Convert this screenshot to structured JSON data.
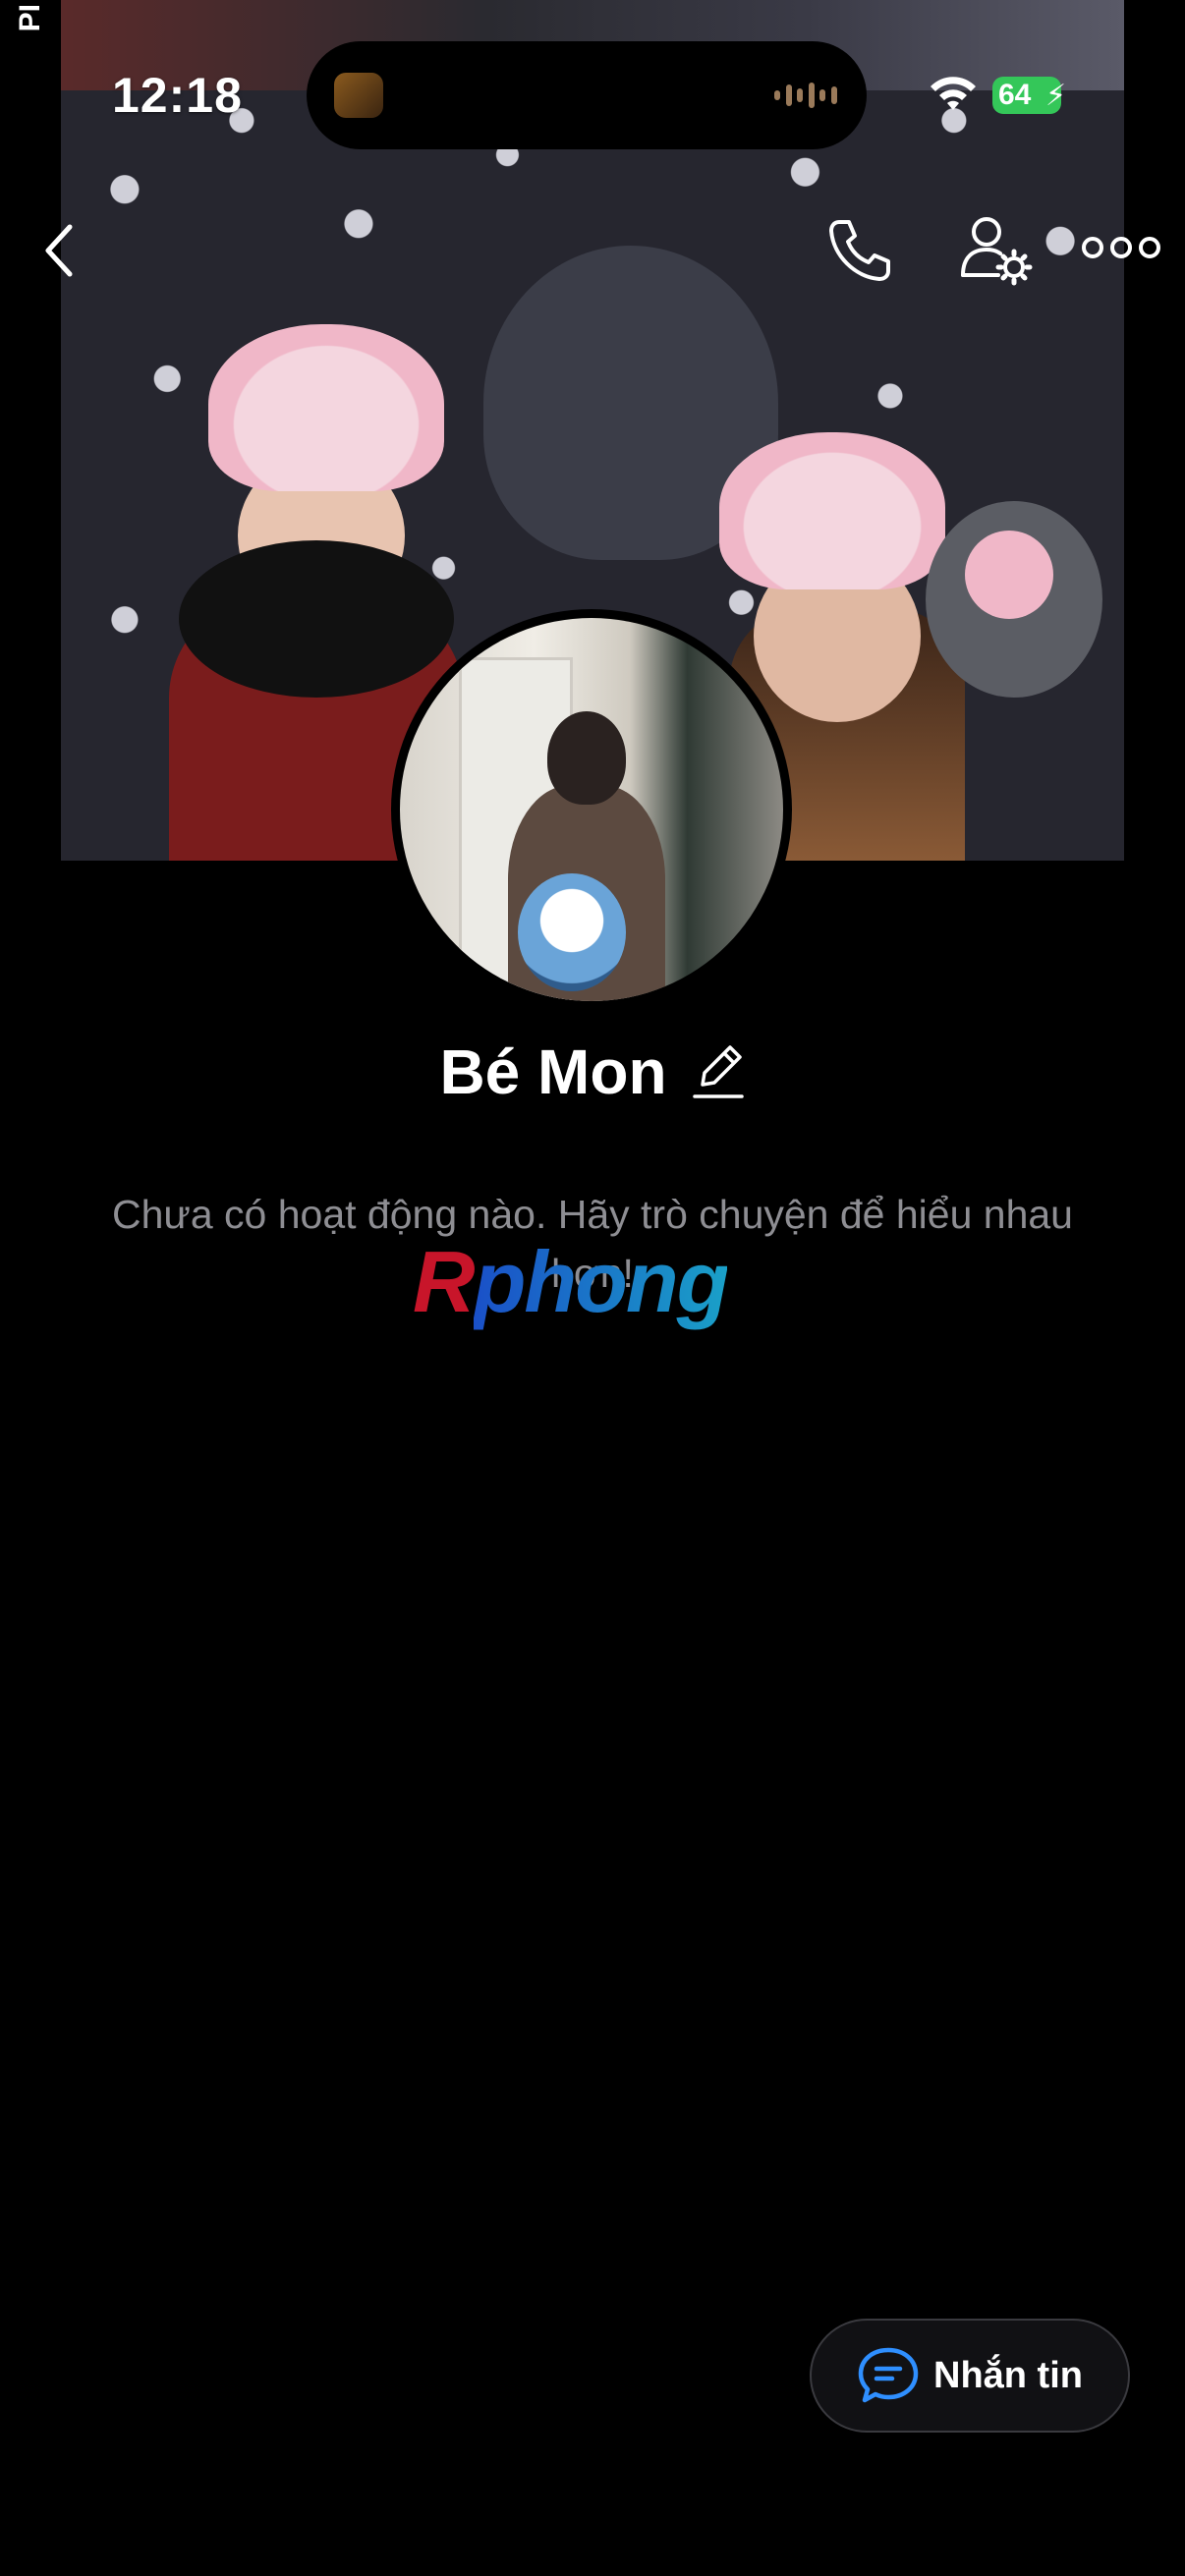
{
  "status_bar": {
    "time": "12:18",
    "battery": "64"
  },
  "side_label": "PI",
  "profile": {
    "name": "Bé Mon"
  },
  "activity": {
    "empty_message": "Chưa có hoạt động nào. Hãy trò chuyện để hiểu nhau hơn!"
  },
  "watermark": {
    "first_letter": "R",
    "rest": "phong"
  },
  "message_button": {
    "label": "Nhắn tin"
  },
  "icons": {
    "back": "chevron-left-icon",
    "call": "phone-icon",
    "profile_settings": "user-gear-icon",
    "more": "more-dots-icon",
    "edit": "pencil-icon",
    "chat": "chat-bubble-icon"
  },
  "colors": {
    "background": "#000000",
    "battery": "#34c759",
    "muted_text": "#8e8e93",
    "accent": "#2f8fff"
  }
}
